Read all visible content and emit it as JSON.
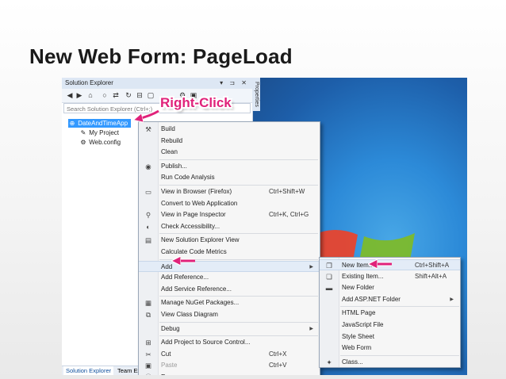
{
  "slide": {
    "title": "New Web Form: PageLoad"
  },
  "solution_explorer": {
    "title": "Solution Explorer",
    "title_controls": "▾ ⊐ ✕",
    "search_placeholder": "Search Solution Explorer (Ctrl+;)",
    "tree": [
      {
        "label": "DateAndTimeApp",
        "icon": "globe-project-icon",
        "selected": true
      },
      {
        "label": "My Project",
        "icon": "wrench-icon",
        "selected": false
      },
      {
        "label": "Web.config",
        "icon": "config-file-icon",
        "selected": false
      }
    ],
    "properties_tab": "Properties",
    "bottom_tabs": [
      "Solution Explorer",
      "Team Ex"
    ]
  },
  "annotation": {
    "label": "Right-Click",
    "color": "#e0227a"
  },
  "context_menu": {
    "items": [
      {
        "label": "Build",
        "icon": "build-icon",
        "glyph": "⚒",
        "shortcut": "",
        "submenu": false,
        "disabled": false
      },
      {
        "label": "Rebuild",
        "icon": "",
        "glyph": "",
        "shortcut": "",
        "submenu": false,
        "disabled": false
      },
      {
        "label": "Clean",
        "icon": "",
        "glyph": "",
        "shortcut": "",
        "submenu": false,
        "disabled": false
      },
      {
        "label": "Publish...",
        "icon": "publish-globe-icon",
        "glyph": "◉",
        "shortcut": "",
        "submenu": false,
        "disabled": false
      },
      {
        "label": "Run Code Analysis",
        "icon": "",
        "glyph": "",
        "shortcut": "",
        "submenu": false,
        "disabled": false
      },
      {
        "label": "View in Browser (Firefox)",
        "icon": "browser-icon",
        "glyph": "▭",
        "shortcut": "Ctrl+Shift+W",
        "submenu": false,
        "disabled": false
      },
      {
        "label": "Convert to Web Application",
        "icon": "",
        "glyph": "",
        "shortcut": "",
        "submenu": false,
        "disabled": false
      },
      {
        "label": "View in Page Inspector",
        "icon": "page-inspector-icon",
        "glyph": "⚲",
        "shortcut": "Ctrl+K, Ctrl+G",
        "submenu": false,
        "disabled": false
      },
      {
        "label": "Check Accessibility...",
        "icon": "accessibility-icon",
        "glyph": "◐",
        "shortcut": "",
        "submenu": false,
        "disabled": false
      },
      {
        "label": "New Solution Explorer View",
        "icon": "solution-view-icon",
        "glyph": "▤",
        "shortcut": "",
        "submenu": false,
        "disabled": false
      },
      {
        "label": "Calculate Code Metrics",
        "icon": "",
        "glyph": "",
        "shortcut": "",
        "submenu": false,
        "disabled": false
      },
      {
        "label": "Add",
        "icon": "",
        "glyph": "",
        "shortcut": "",
        "submenu": true,
        "disabled": false,
        "highlighted": true
      },
      {
        "label": "Add Reference...",
        "icon": "",
        "glyph": "",
        "shortcut": "",
        "submenu": false,
        "disabled": false
      },
      {
        "label": "Add Service Reference...",
        "icon": "",
        "glyph": "",
        "shortcut": "",
        "submenu": false,
        "disabled": false
      },
      {
        "label": "Manage NuGet Packages...",
        "icon": "nuget-icon",
        "glyph": "▦",
        "shortcut": "",
        "submenu": false,
        "disabled": false
      },
      {
        "label": "View Class Diagram",
        "icon": "class-diagram-icon",
        "glyph": "⧉",
        "shortcut": "",
        "submenu": false,
        "disabled": false
      },
      {
        "label": "Debug",
        "icon": "",
        "glyph": "",
        "shortcut": "",
        "submenu": true,
        "disabled": false
      },
      {
        "label": "Add Project to Source Control...",
        "icon": "source-control-icon",
        "glyph": "⊞",
        "shortcut": "",
        "submenu": false,
        "disabled": false
      },
      {
        "label": "Cut",
        "icon": "scissors-icon",
        "glyph": "✂",
        "shortcut": "Ctrl+X",
        "submenu": false,
        "disabled": false
      },
      {
        "label": "Paste",
        "icon": "paste-icon",
        "glyph": "▣",
        "shortcut": "Ctrl+V",
        "submenu": false,
        "disabled": true
      },
      {
        "label": "Rename",
        "icon": "rename-icon",
        "glyph": "Ⓘ",
        "shortcut": "",
        "submenu": false,
        "disabled": false
      }
    ]
  },
  "add_submenu": {
    "items": [
      {
        "label": "New Item...",
        "icon": "new-item-icon",
        "glyph": "❐",
        "shortcut": "Ctrl+Shift+A",
        "submenu": false,
        "disabled": false,
        "highlighted": true
      },
      {
        "label": "Existing Item...",
        "icon": "existing-item-icon",
        "glyph": "❏",
        "shortcut": "Shift+Alt+A",
        "submenu": false,
        "disabled": false
      },
      {
        "label": "New Folder",
        "icon": "folder-icon",
        "glyph": "▬",
        "shortcut": "",
        "submenu": false,
        "disabled": false
      },
      {
        "label": "Add ASP.NET Folder",
        "icon": "",
        "glyph": "",
        "shortcut": "",
        "submenu": true,
        "disabled": false
      },
      {
        "label": "HTML Page",
        "icon": "",
        "glyph": "",
        "shortcut": "",
        "submenu": false,
        "disabled": false
      },
      {
        "label": "JavaScript File",
        "icon": "",
        "glyph": "",
        "shortcut": "",
        "submenu": false,
        "disabled": false
      },
      {
        "label": "Style Sheet",
        "icon": "",
        "glyph": "",
        "shortcut": "",
        "submenu": false,
        "disabled": false
      },
      {
        "label": "Web Form",
        "icon": "",
        "glyph": "",
        "shortcut": "",
        "submenu": false,
        "disabled": false
      },
      {
        "label": "Class...",
        "icon": "class-icon",
        "glyph": "✦",
        "shortcut": "",
        "submenu": false,
        "disabled": false
      }
    ]
  },
  "colors": {
    "selection": "#3399ff",
    "annotation": "#e0227a",
    "desktop": "#2c8ad8"
  }
}
